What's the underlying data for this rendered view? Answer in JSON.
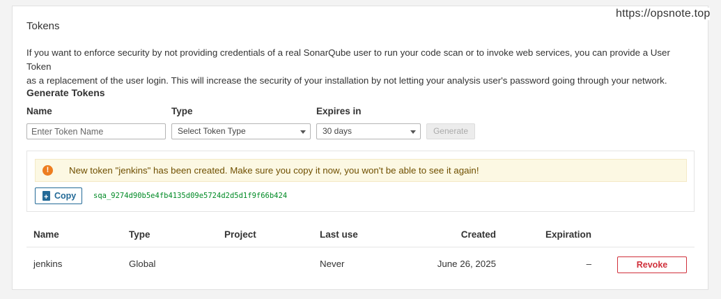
{
  "watermark": "https://opsnote.top",
  "section_title": "Tokens",
  "description_line1": "If you want to enforce security by not providing credentials of a real SonarQube user to run your code scan or to invoke web services, you can provide a User Token",
  "description_line2": "as a replacement of the user login. This will increase the security of your installation by not letting your analysis user's password going through your network.",
  "generate": {
    "heading": "Generate Tokens",
    "name_label": "Name",
    "name_placeholder": "Enter Token Name",
    "name_value": "",
    "type_label": "Type",
    "type_selected": "Select Token Type",
    "expires_label": "Expires in",
    "expires_selected": "30 days",
    "button_label": "Generate"
  },
  "new_token": {
    "alert_icon": "warning-icon",
    "alert_text": "New token \"jenkins\" has been created. Make sure you copy it now, you won't be able to see it again!",
    "copy_label": "Copy",
    "copy_icon": "clipboard-icon",
    "value": "sqa_9274d90b5e4fb4135d09e5724d2d5d1f9f66b424"
  },
  "table": {
    "headers": {
      "name": "Name",
      "type": "Type",
      "project": "Project",
      "last_use": "Last use",
      "created": "Created",
      "expiration": "Expiration"
    },
    "rows": [
      {
        "name": "jenkins",
        "type": "Global",
        "project": "",
        "last_use": "Never",
        "created": "June 26, 2025",
        "expiration": "–",
        "action": "Revoke"
      }
    ]
  },
  "colors": {
    "accent": "#236a97",
    "danger": "#d02f3a",
    "warning_bg": "#fcf8e3",
    "warning_icon": "#ed7d20",
    "token_text": "#008a25"
  }
}
